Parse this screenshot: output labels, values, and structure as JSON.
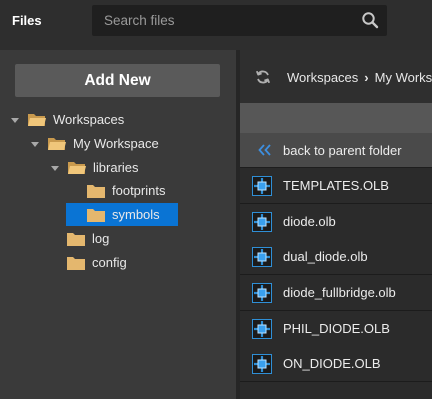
{
  "app": {
    "title": "Files"
  },
  "search": {
    "placeholder": "Search files"
  },
  "sidebar": {
    "add_new_label": "Add New",
    "tree": [
      {
        "label": "Workspaces"
      },
      {
        "label": "My Workspace"
      },
      {
        "label": "libraries"
      },
      {
        "label": "footprints"
      },
      {
        "label": "symbols",
        "selected": true
      },
      {
        "label": "log"
      },
      {
        "label": "config"
      }
    ]
  },
  "breadcrumb": {
    "items": [
      "Workspaces",
      "My Worksp"
    ],
    "separator": "›"
  },
  "file_list": {
    "back_label": "back to parent folder",
    "files": [
      {
        "name": "TEMPLATES.OLB"
      },
      {
        "name": "diode.olb"
      },
      {
        "name": "dual_diode.olb"
      },
      {
        "name": "diode_fullbridge.olb"
      },
      {
        "name": "PHIL_DIODE.OLB"
      },
      {
        "name": "ON_DIODE.OLB"
      }
    ]
  },
  "colors": {
    "accent": "#0a74d4",
    "folder": "#e4b76e",
    "file_icon": "#2f8fd6"
  }
}
